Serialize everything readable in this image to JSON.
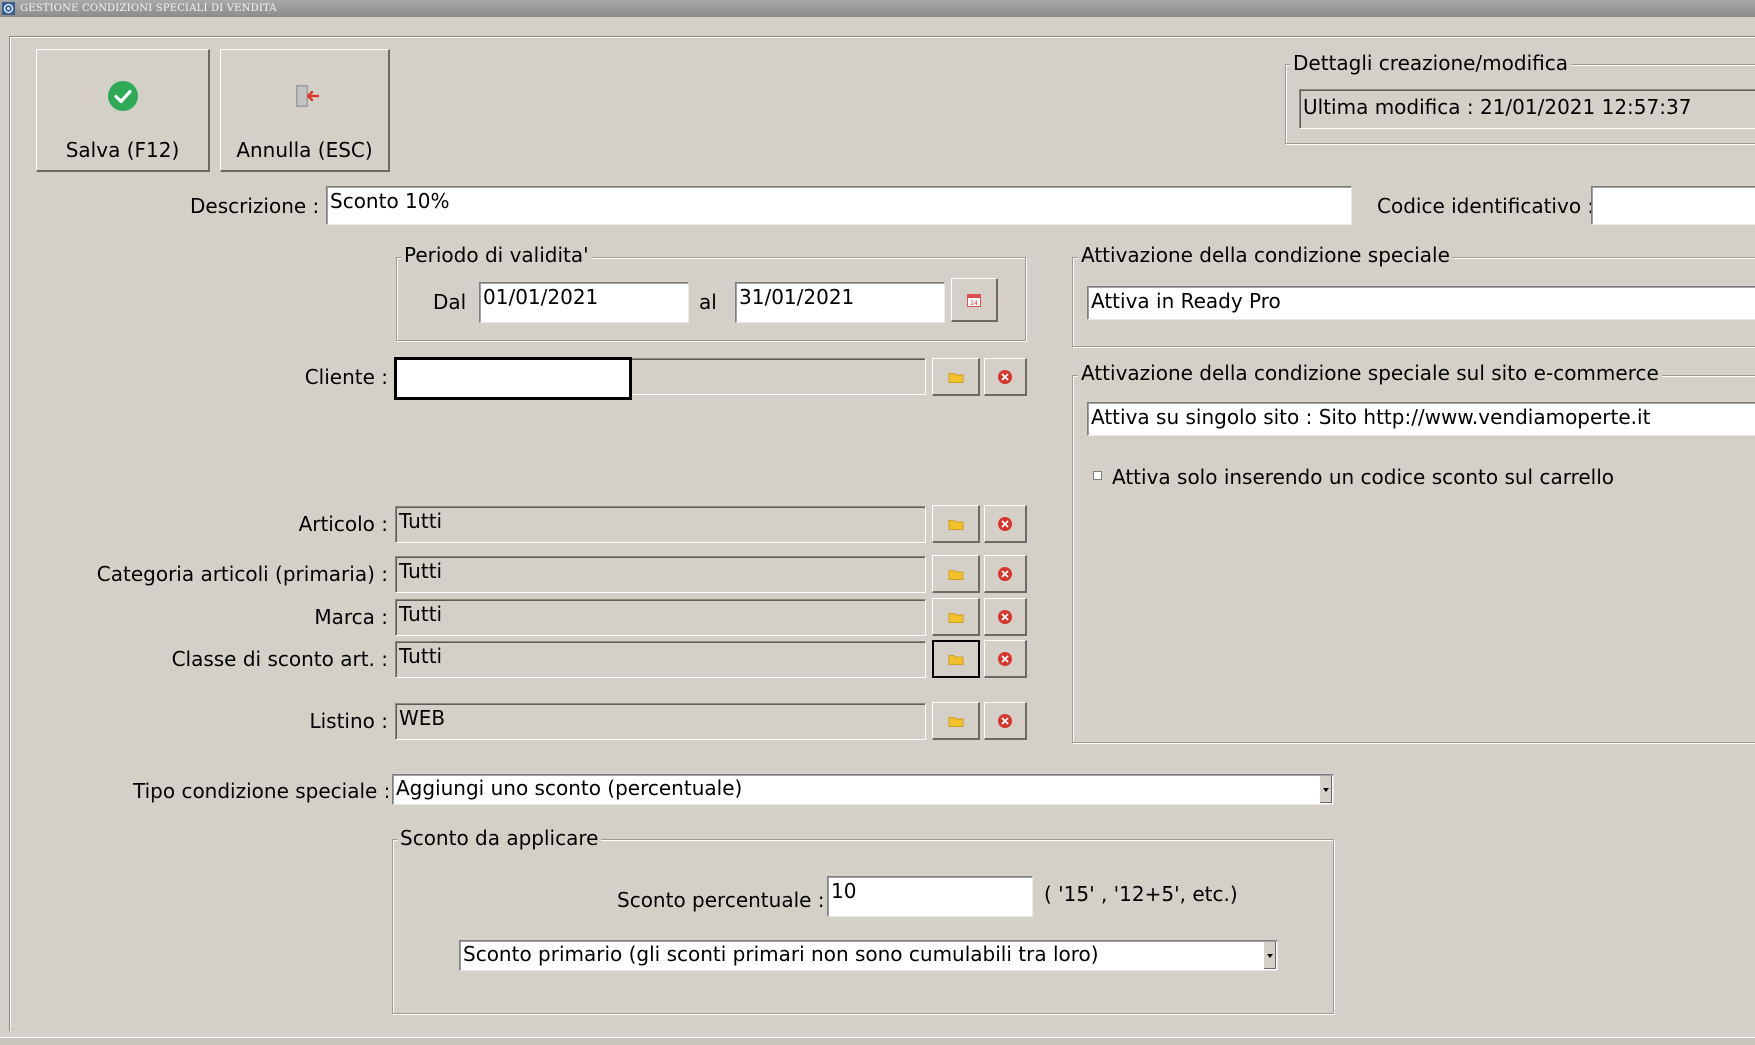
{
  "window": {
    "title": "GESTIONE CONDIZIONI SPECIALI DI VENDITA"
  },
  "toolbar": {
    "save_label": "Salva (F12)",
    "cancel_label": "Annulla (ESC)"
  },
  "details": {
    "group_title": "Dettagli creazione/modifica",
    "last_modified": "Ultima modifica : 21/01/2021  12:57:37"
  },
  "form": {
    "descrizione_label": "Descrizione :",
    "descrizione_value": "Sconto 10%",
    "codice_label": "Codice identificativo :",
    "codice_value": "",
    "periodo": {
      "title": "Periodo di validita'",
      "dal_label": "Dal",
      "dal_value": "01/01/2021",
      "al_label": "al",
      "al_value": "31/01/2021"
    },
    "cliente_label": "Cliente :",
    "cliente_value": "",
    "articolo_label": "Articolo :",
    "articolo_value": "Tutti",
    "categoria_label": "Categoria articoli (primaria) :",
    "categoria_value": "Tutti",
    "marca_label": "Marca :",
    "marca_value": "Tutti",
    "classe_label": "Classe di sconto art. :",
    "classe_value": "Tutti",
    "listino_label": "Listino :",
    "listino_value": "WEB",
    "tipo_label": "Tipo condizione speciale :",
    "tipo_value": "Aggiungi uno sconto (percentuale)"
  },
  "attivazione": {
    "title": "Attivazione della condizione speciale",
    "value": "Attiva in Ready Pro",
    "ecommerce_title": "Attivazione della condizione speciale sul sito e-commerce",
    "ecommerce_value": "Attiva su singolo sito : Sito http://www.vendiamoperte.it",
    "codice_sconto_checkbox": "Attiva solo inserendo un codice sconto sul carrello"
  },
  "sconto": {
    "title": "Sconto da applicare",
    "percentuale_label": "Sconto percentuale :",
    "percentuale_value": "10",
    "hint": "( '15' ,  '12+5', etc.)",
    "tipo_value": "Sconto primario (gli sconti primari non sono cumulabili tra loro)"
  },
  "colors": {
    "accent_green": "#2eaa57",
    "delete_red": "#d6362d",
    "folder_yellow": "#f3c12a"
  }
}
